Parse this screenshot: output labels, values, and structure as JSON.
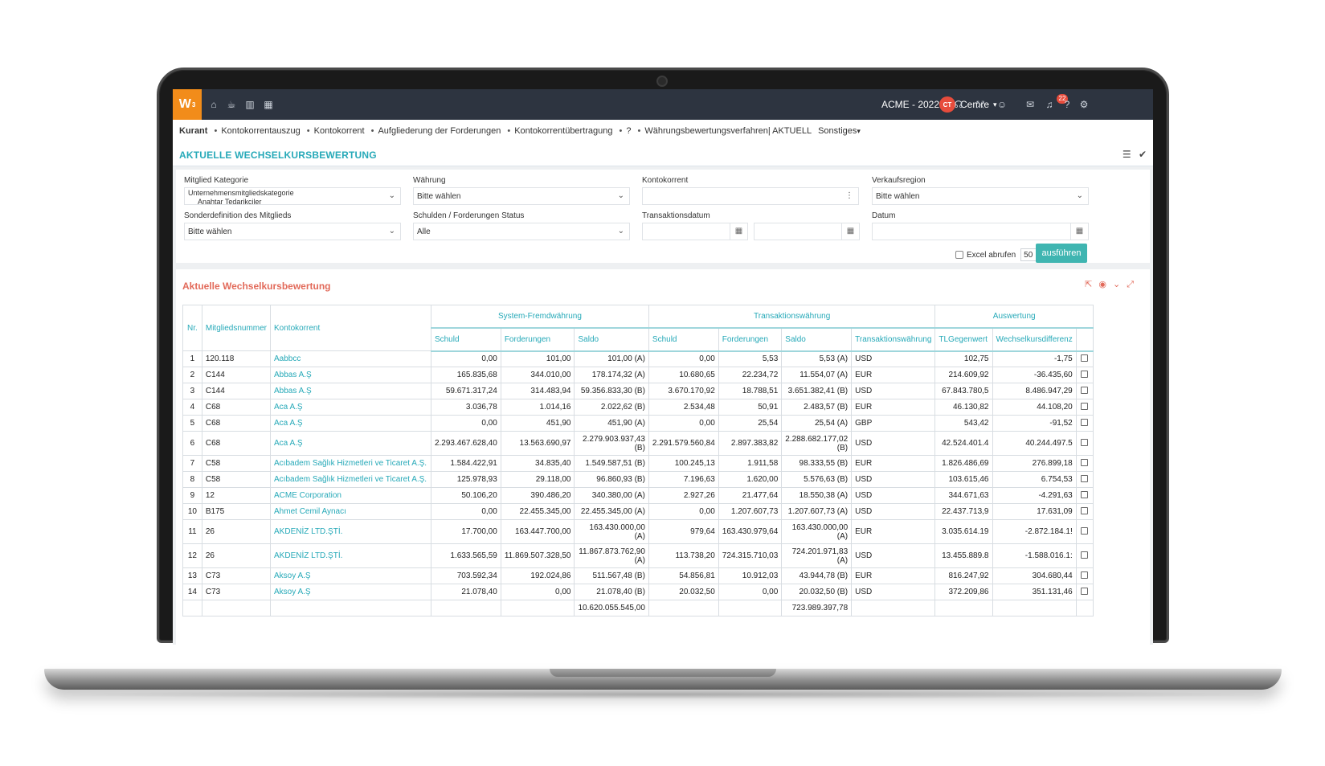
{
  "topbar": {
    "logo_text": "W",
    "logo_sup": "3",
    "company": "ACME - 2022",
    "avatar_initials": "CT",
    "username": "Cemre",
    "notification_count": "22",
    "nav_icons": [
      "home-icon",
      "coffee-icon",
      "bar-chart-icon",
      "calendar-icon"
    ],
    "right_icons": [
      "headset-icon",
      "share-icon",
      "smiley-icon",
      "chat-icon",
      "bell-icon",
      "help-icon",
      "gear-icon"
    ]
  },
  "breadcrumb": {
    "items": [
      "Kurant",
      "Kontokorrentauszug",
      "Kontokorrent",
      "Aufgliederung der Forderungen",
      "Kontokorrentübertragung",
      "?",
      "Währungsbewertungsverfahren| AKTUELL"
    ],
    "more_label": "Sonstiges"
  },
  "page": {
    "title": "AKTUELLE WECHSELKURSBEWERTUNG"
  },
  "filters": {
    "member_category_label": "Mitglied Kategorie",
    "member_category_value_1": "Unternehmensmitgliedskategorie",
    "member_category_value_2": "Anahtar Tedarikciler",
    "currency_label": "Währung",
    "currency_value": "Bitte wählen",
    "account_label": "Kontokorrent",
    "account_value": "",
    "region_label": "Verkaufsregion",
    "region_value": "Bitte wählen",
    "member_special_label": "Sonderdefinition des Mitglieds",
    "member_special_value": "Bitte wählen",
    "debt_status_label": "Schulden / Forderungen Status",
    "debt_status_value": "Alle",
    "transaction_date_label": "Transaktionsdatum",
    "date_label": "Datum",
    "excel_label": "Excel abrufen",
    "page_size": "50",
    "run_label": "ausführen"
  },
  "report": {
    "title": "Aktuelle Wechselkursbewertung",
    "group_headers": {
      "system": "System-Fremdwährung",
      "transaction": "Transaktionswährung",
      "evaluation": "Auswertung"
    },
    "columns": {
      "nr": "Nr.",
      "member_no": "Mitgliedsnummer",
      "account": "Kontokorrent",
      "sys_debt": "Schuld",
      "sys_credit": "Forderungen",
      "sys_balance": "Saldo",
      "tr_debt": "Schuld",
      "tr_credit": "Forderungen",
      "tr_balance": "Saldo",
      "tr_currency": "Transaktionswährung",
      "tl_value": "TLGegenwert",
      "fx_diff": "Wechselkursdifferenz"
    },
    "rows": [
      {
        "nr": "1",
        "member": "120.118",
        "account": "Aabbcc",
        "sd": "0,00",
        "sc": "101,00",
        "sb": "101,00 (A)",
        "td": "0,00",
        "tc": "5,53",
        "tb": "5,53 (A)",
        "cur": "USD",
        "tl": "102,75",
        "diff": "-1,75"
      },
      {
        "nr": "2",
        "member": "C144",
        "account": "Abbas A.Ş",
        "sd": "165.835,68",
        "sc": "344.010,00",
        "sb": "178.174,32 (A)",
        "td": "10.680,65",
        "tc": "22.234,72",
        "tb": "11.554,07 (A)",
        "cur": "EUR",
        "tl": "214.609,92",
        "diff": "-36.435,60"
      },
      {
        "nr": "3",
        "member": "C144",
        "account": "Abbas A.Ş",
        "sd": "59.671.317,24",
        "sc": "314.483,94",
        "sb": "59.356.833,30 (B)",
        "td": "3.670.170,92",
        "tc": "18.788,51",
        "tb": "3.651.382,41 (B)",
        "cur": "USD",
        "tl": "67.843.780,5",
        "diff": "8.486.947,29"
      },
      {
        "nr": "4",
        "member": "C68",
        "account": "Aca A.Ş",
        "sd": "3.036,78",
        "sc": "1.014,16",
        "sb": "2.022,62 (B)",
        "td": "2.534,48",
        "tc": "50,91",
        "tb": "2.483,57 (B)",
        "cur": "EUR",
        "tl": "46.130,82",
        "diff": "44.108,20"
      },
      {
        "nr": "5",
        "member": "C68",
        "account": "Aca A.Ş",
        "sd": "0,00",
        "sc": "451,90",
        "sb": "451,90 (A)",
        "td": "0,00",
        "tc": "25,54",
        "tb": "25,54 (A)",
        "cur": "GBP",
        "tl": "543,42",
        "diff": "-91,52"
      },
      {
        "nr": "6",
        "member": "C68",
        "account": "Aca A.Ş",
        "sd": "2.293.467.628,40",
        "sc": "13.563.690,97",
        "sb": "2.279.903.937,43 (B)",
        "td": "2.291.579.560,84",
        "tc": "2.897.383,82",
        "tb": "2.288.682.177,02 (B)",
        "cur": "USD",
        "tl": "42.524.401.4",
        "diff": "40.244.497.5",
        "tall": true
      },
      {
        "nr": "7",
        "member": "C58",
        "account": "Acıbadem Sağlık Hizmetleri ve Ticaret A.Ş.",
        "sd": "1.584.422,91",
        "sc": "34.835,40",
        "sb": "1.549.587,51 (B)",
        "td": "100.245,13",
        "tc": "1.911,58",
        "tb": "98.333,55 (B)",
        "cur": "EUR",
        "tl": "1.826.486,69",
        "diff": "276.899,18"
      },
      {
        "nr": "8",
        "member": "C58",
        "account": "Acıbadem Sağlık Hizmetleri ve Ticaret A.Ş.",
        "sd": "125.978,93",
        "sc": "29.118,00",
        "sb": "96.860,93 (B)",
        "td": "7.196,63",
        "tc": "1.620,00",
        "tb": "5.576,63 (B)",
        "cur": "USD",
        "tl": "103.615,46",
        "diff": "6.754,53"
      },
      {
        "nr": "9",
        "member": "12",
        "account": "ACME Corporation",
        "sd": "50.106,20",
        "sc": "390.486,20",
        "sb": "340.380,00 (A)",
        "td": "2.927,26",
        "tc": "21.477,64",
        "tb": "18.550,38 (A)",
        "cur": "USD",
        "tl": "344.671,63",
        "diff": "-4.291,63"
      },
      {
        "nr": "10",
        "member": "B175",
        "account": "Ahmet Cemil Aynacı",
        "sd": "0,00",
        "sc": "22.455.345,00",
        "sb": "22.455.345,00 (A)",
        "td": "0,00",
        "tc": "1.207.607,73",
        "tb": "1.207.607,73 (A)",
        "cur": "USD",
        "tl": "22.437.713,9",
        "diff": "17.631,09"
      },
      {
        "nr": "11",
        "member": "26",
        "account": "AKDENİZ LTD.ŞTİ.",
        "sd": "17.700,00",
        "sc": "163.447.700,00",
        "sb": "163.430.000,00 (A)",
        "td": "979,64",
        "tc": "163.430.979,64",
        "tb": "163.430.000,00 (A)",
        "cur": "EUR",
        "tl": "3.035.614.19",
        "diff": "-2.872.184.1!",
        "tall": true
      },
      {
        "nr": "12",
        "member": "26",
        "account": "AKDENİZ LTD.ŞTİ.",
        "sd": "1.633.565,59",
        "sc": "11.869.507.328,50",
        "sb": "11.867.873.762,90 (A)",
        "td": "113.738,20",
        "tc": "724.315.710,03",
        "tb": "724.201.971,83 (A)",
        "cur": "USD",
        "tl": "13.455.889.8",
        "diff": "-1.588.016.1:",
        "tall": true
      },
      {
        "nr": "13",
        "member": "C73",
        "account": "Aksoy A.Ş",
        "sd": "703.592,34",
        "sc": "192.024,86",
        "sb": "511.567,48 (B)",
        "td": "54.856,81",
        "tc": "10.912,03",
        "tb": "43.944,78 (B)",
        "cur": "EUR",
        "tl": "816.247,92",
        "diff": "304.680,44"
      },
      {
        "nr": "14",
        "member": "C73",
        "account": "Aksoy A.Ş",
        "sd": "21.078,40",
        "sc": "0,00",
        "sb": "21.078,40 (B)",
        "td": "20.032,50",
        "tc": "0,00",
        "tb": "20.032,50 (B)",
        "cur": "USD",
        "tl": "372.209,86",
        "diff": "351.131,46"
      },
      {
        "nr": "",
        "member": "",
        "account": "",
        "sd": "",
        "sc": "",
        "sb": "10.620.055.545,00",
        "td": "",
        "tc": "",
        "tb": "723.989.397,78",
        "cur": "",
        "tl": "",
        "diff": ""
      }
    ]
  }
}
